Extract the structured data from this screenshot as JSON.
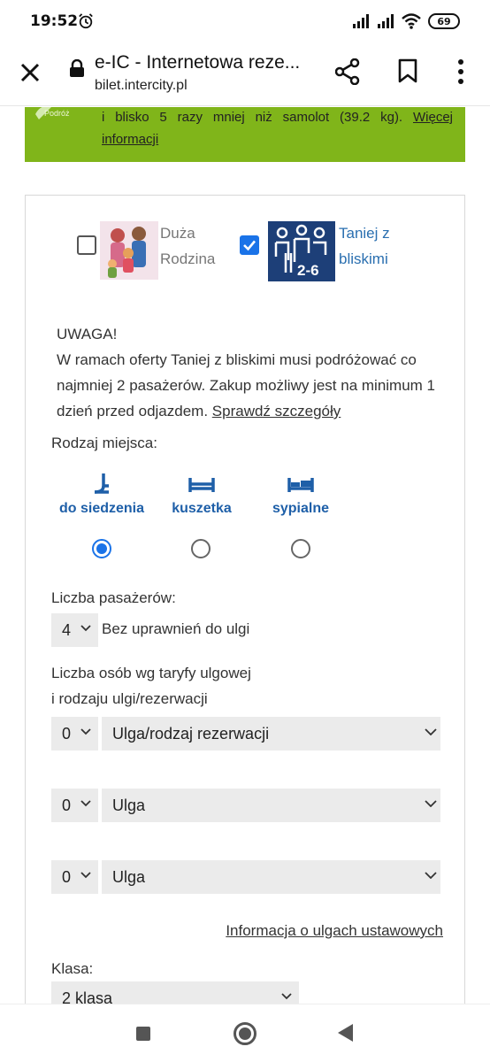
{
  "status_bar": {
    "time": "19:52",
    "battery": "69"
  },
  "browser": {
    "title": "e-IC - Internetowa reze...",
    "url": "bilet.intercity.pl"
  },
  "eco_banner": {
    "logo_text": "Podróż",
    "line1": "i blisko 5 razy mniej niż samolot (39.2 kg).",
    "link_part1": "Więcej",
    "link_part2": "informacji"
  },
  "offers": [
    {
      "label_line1": "Duża",
      "label_line2": "Rodzina",
      "checked": false
    },
    {
      "label_line1": "Taniej z",
      "label_line2": "bliskimi",
      "checked": true,
      "badge": "2-6"
    }
  ],
  "notice": {
    "heading": "UWAGA!",
    "text": "W ramach oferty Taniej z bliskimi musi podróżować co najmniej 2 pasażerów. Zakup możliwy jest na minimum 1 dzień przed odjazdem.",
    "link": "Sprawdź szczegóły"
  },
  "seat_type": {
    "label": "Rodzaj miejsca:",
    "options": [
      "do siedzenia",
      "kuszetka",
      "sypialne"
    ],
    "selected_index": 0
  },
  "passengers": {
    "label": "Liczba pasażerów:",
    "count": "4",
    "description": "Bez uprawnień do ulgi"
  },
  "discounts": {
    "label_line1": "Liczba osób wg taryfy ulgowej",
    "label_line2": "i rodzaju ulgi/rezerwacji",
    "rows": [
      {
        "count": "0",
        "type": "Ulga/rodzaj rezerwacji"
      },
      {
        "count": "0",
        "type": "Ulga"
      },
      {
        "count": "0",
        "type": "Ulga"
      }
    ],
    "info_link": "Informacja o ulgach ustawowych"
  },
  "class_select": {
    "label": "Klasa:",
    "value": "2 klasa"
  },
  "colors": {
    "accent": "#1a73e8",
    "eco_green": "#80b51a",
    "seat_blue": "#1e5fa8"
  }
}
